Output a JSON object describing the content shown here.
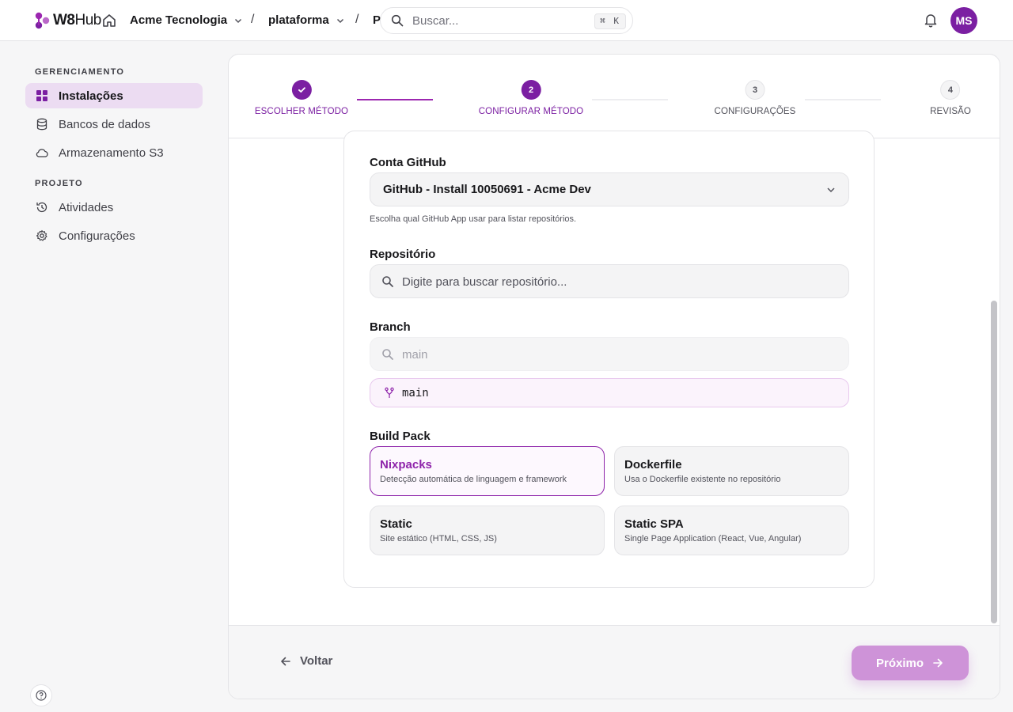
{
  "brand": {
    "logo_text": "W8",
    "logo_text_thin": "Hub",
    "accent": "#7b1fa2"
  },
  "header": {
    "org": "Acme Tecnologia",
    "separator": "/",
    "project": "plataforma",
    "page_truncated": "P",
    "search": {
      "placeholder": "Buscar...",
      "shortcut": "⌘ K"
    },
    "user_initials": "MS"
  },
  "sidebar": {
    "sections": [
      {
        "label": "GERENCIAMENTO",
        "items": [
          {
            "label": "Instalações",
            "icon": "grid-icon",
            "active": true
          },
          {
            "label": "Bancos de dados",
            "icon": "database-icon"
          },
          {
            "label": "Armazenamento S3",
            "icon": "cloud-icon"
          }
        ]
      },
      {
        "label": "PROJETO",
        "items": [
          {
            "label": "Atividades",
            "icon": "history-icon"
          },
          {
            "label": "Configurações",
            "icon": "gear-icon"
          }
        ]
      }
    ]
  },
  "stepper": {
    "steps": [
      {
        "number": "1",
        "label": "ESCOLHER MÉTODO",
        "state": "done"
      },
      {
        "number": "2",
        "label": "CONFIGURAR MÉTODO",
        "state": "current"
      },
      {
        "number": "3",
        "label": "CONFIGURAÇÕES",
        "state": "todo"
      },
      {
        "number": "4",
        "label": "REVISÃO",
        "state": "todo"
      }
    ]
  },
  "form": {
    "github_account": {
      "label": "Conta GitHub",
      "value": "GitHub - Install 10050691 - Acme Dev",
      "hint": "Escolha qual GitHub App usar para listar repositórios."
    },
    "repository": {
      "label": "Repositório",
      "placeholder": "Digite para buscar repositório..."
    },
    "branch": {
      "label": "Branch",
      "placeholder": "main",
      "selected": "main"
    },
    "build_pack": {
      "label": "Build Pack",
      "options": [
        {
          "title": "Nixpacks",
          "description": "Detecção automática de linguagem e framework",
          "selected": true
        },
        {
          "title": "Dockerfile",
          "description": "Usa o Dockerfile existente no repositório",
          "selected": false
        },
        {
          "title": "Static",
          "description": "Site estático (HTML, CSS, JS)",
          "selected": false
        },
        {
          "title": "Static SPA",
          "description": "Single Page Application (React, Vue, Angular)",
          "selected": false
        }
      ]
    }
  },
  "footer": {
    "back_label": "Voltar",
    "next_label": "Próximo"
  }
}
